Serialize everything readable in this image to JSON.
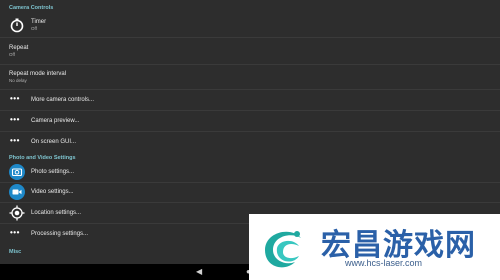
{
  "sections": {
    "camera_controls": "Camera Controls",
    "photo_video": "Photo and Video Settings",
    "misc": "Misc"
  },
  "prefs": {
    "timer": {
      "title": "Timer",
      "summary": "Off"
    },
    "repeat": {
      "title": "Repeat",
      "summary": "Off"
    },
    "repeat_interval": {
      "title": "Repeat mode interval",
      "summary": "No delay"
    },
    "more_camera_controls": {
      "title": "More camera controls..."
    },
    "camera_preview": {
      "title": "Camera preview..."
    },
    "onscreen_gui": {
      "title": "On screen GUI..."
    },
    "photo_settings": {
      "title": "Photo settings..."
    },
    "video_settings": {
      "title": "Video settings..."
    },
    "location_settings": {
      "title": "Location settings..."
    },
    "processing_settings": {
      "title": "Processing settings..."
    }
  },
  "navbar": {
    "back": "◀",
    "home": "●",
    "recents": "■"
  },
  "watermark": {
    "text": "宏昌游戏网",
    "url": "www.hcs-laser.com"
  },
  "colors": {
    "accent": "#7ec4cf",
    "background": "#2d2d2d",
    "icon_circle": "#1e88c8"
  }
}
